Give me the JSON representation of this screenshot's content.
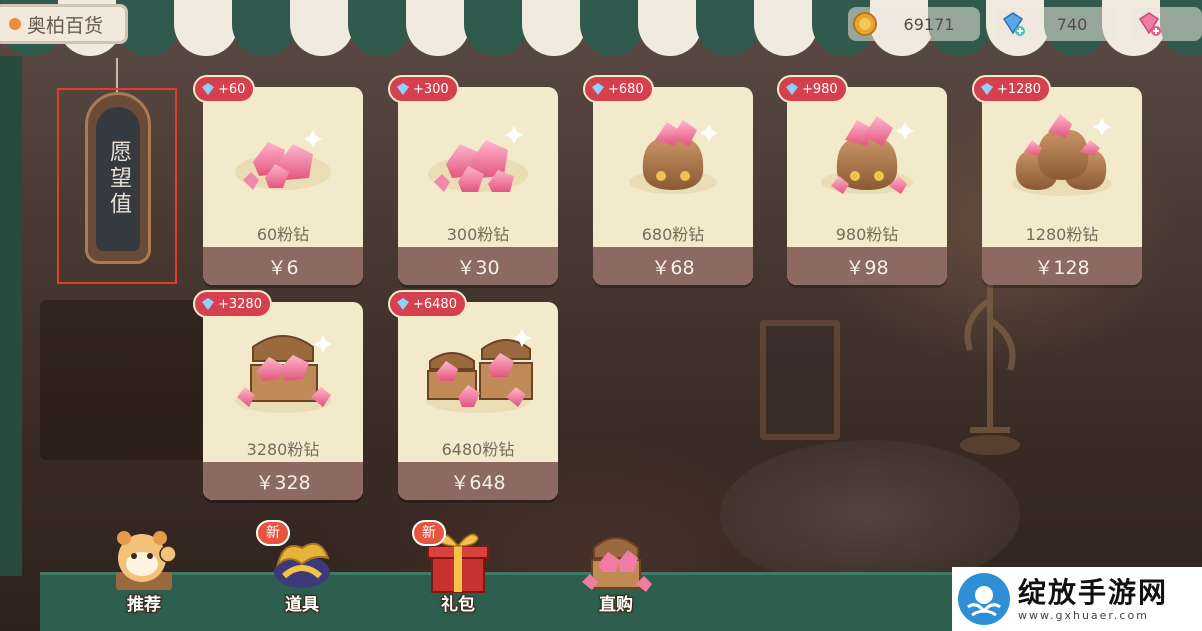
{
  "store": {
    "name": "奥柏百货"
  },
  "currencies": [
    {
      "icon": "gold-coin-icon",
      "value": "69171"
    },
    {
      "icon": "blue-diamond-plus-icon",
      "value": "740"
    },
    {
      "icon": "pink-diamond-plus-icon",
      "value": ""
    }
  ],
  "wish": {
    "label": "愿望值"
  },
  "products": [
    {
      "bonus": "+60",
      "name": "60粉钻",
      "price": "￥6",
      "art": "gem-pile-icon"
    },
    {
      "bonus": "+300",
      "name": "300粉钻",
      "price": "￥30",
      "art": "gem-pile-icon"
    },
    {
      "bonus": "+680",
      "name": "680粉钻",
      "price": "￥68",
      "art": "gem-bag-icon"
    },
    {
      "bonus": "+980",
      "name": "980粉钻",
      "price": "￥98",
      "art": "gem-bag-icon"
    },
    {
      "bonus": "+1280",
      "name": "1280粉钻",
      "price": "￥128",
      "art": "gem-bags-icon"
    },
    {
      "bonus": "+3280",
      "name": "3280粉钻",
      "price": "￥328",
      "art": "gem-chest-icon"
    },
    {
      "bonus": "+6480",
      "name": "6480粉钻",
      "price": "￥648",
      "art": "gem-chests-icon"
    }
  ],
  "nav": [
    {
      "label": "推荐",
      "icon": "hamster-mascot-icon",
      "badge": ""
    },
    {
      "label": "道具",
      "icon": "gold-ribbon-icon",
      "badge": "新"
    },
    {
      "label": "礼包",
      "icon": "gift-box-icon",
      "badge": "新"
    },
    {
      "label": "直购",
      "icon": "treasure-chest-icon",
      "badge": ""
    }
  ],
  "watermark": {
    "title": "绽放手游网",
    "url": "www.gxhuaer.com"
  },
  "colors": {
    "awning_green": "#2f5a4d",
    "awning_white": "#f1ebdf",
    "card_bg": "#f3e9cb",
    "price_bar": "#8c6a62",
    "bonus_red": "#d4404e",
    "nav_green": "#2e5e4e",
    "wish_outline": "#e33b2e"
  }
}
